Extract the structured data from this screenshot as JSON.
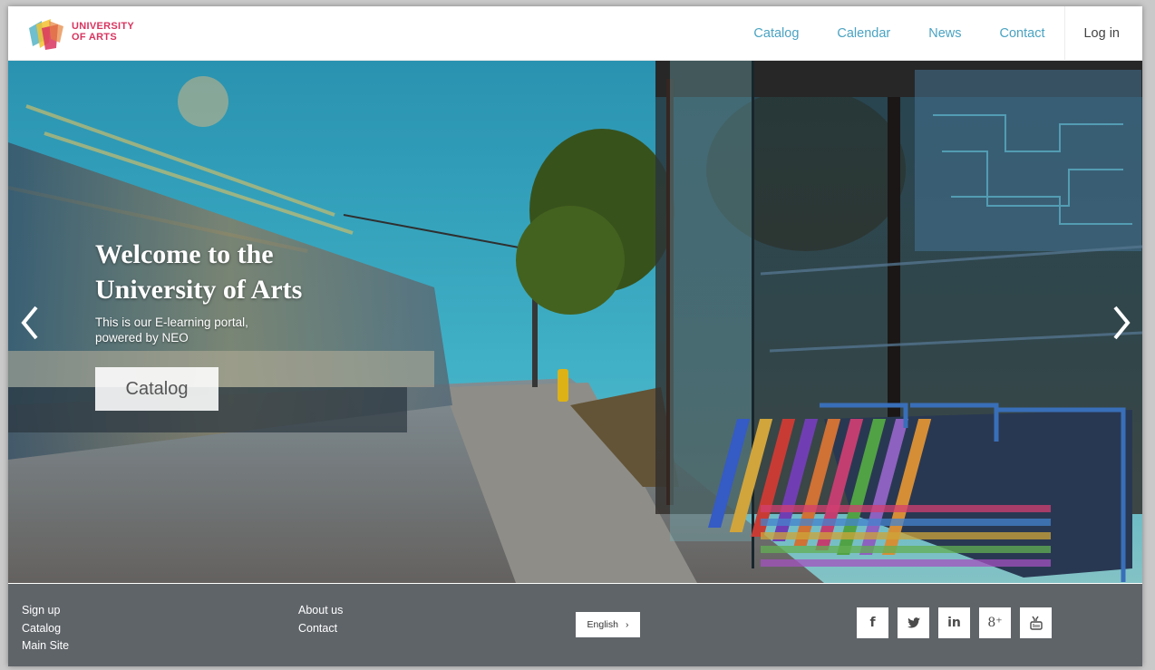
{
  "header": {
    "logo_line1": "UNIVERSITY",
    "logo_line2": "OF ARTS",
    "nav": [
      "Catalog",
      "Calendar",
      "News",
      "Contact"
    ],
    "login": "Log in"
  },
  "hero": {
    "title": "Welcome to the University of Arts",
    "subtitle": "This is our E-learning portal, powered by NEO",
    "button": "Catalog",
    "prev_icon": "chevron-left-icon",
    "next_icon": "chevron-right-icon"
  },
  "footer": {
    "col1": [
      "Sign up",
      "Catalog",
      "Main Site"
    ],
    "col2": [
      "About us",
      "Contact"
    ],
    "language": "English",
    "social": [
      {
        "name": "facebook-icon",
        "glyph": "f"
      },
      {
        "name": "twitter-icon",
        "glyph": "▼"
      },
      {
        "name": "linkedin-icon",
        "glyph": "in"
      },
      {
        "name": "google-plus-icon",
        "glyph": "8⁺"
      },
      {
        "name": "youtube-icon",
        "glyph": "⌷"
      }
    ]
  },
  "colors": {
    "nav_link": "#4aa3c2",
    "footer_bg": "#5f6469",
    "logo_accent": "#d8345f"
  }
}
